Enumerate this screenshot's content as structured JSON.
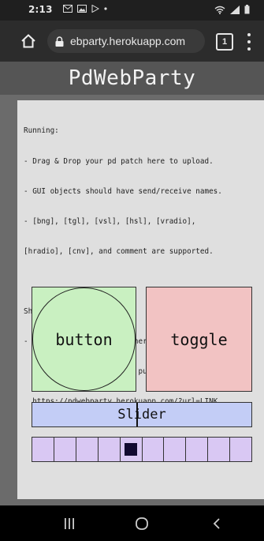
{
  "status_bar": {
    "time": "2:13",
    "left_icons": [
      "gmail-icon",
      "image-icon",
      "play-icon",
      "dot-icon"
    ],
    "right_icons": [
      "wifi-icon",
      "signal-icon",
      "battery-icon"
    ]
  },
  "browser": {
    "url": "ebparty.herokuapp.com",
    "tab_count": "1"
  },
  "page": {
    "title": "PdWebParty",
    "info_lines": [
      "Running:",
      "- Drag & Drop your pd patch here to upload.",
      "- GUI objects should have send/receive names.",
      "- [bng], [tgl], [vsl], [hsl], [vradio],",
      "[hradio], [cnv], and comment are supported.",
      "",
      "Sharing:",
      "- Upload your patch somewhere on the internet",
      "  (e.g. Patchstorage) and put the download LINK",
      "  https://pdwebparty.herokuapp.com/?url=LINK"
    ]
  },
  "gui": {
    "button": {
      "label": "button",
      "color": "#c9f0c1"
    },
    "toggle": {
      "label": "toggle",
      "color": "#f2c3c3"
    },
    "slider": {
      "label": "Slider",
      "color": "#c3cdf6",
      "value_fraction": 0.48
    },
    "radio": {
      "cells": 10,
      "selected_index": 4,
      "color": "#d9c8f3"
    }
  },
  "nav": {
    "items": [
      "recent-apps-icon",
      "home-icon",
      "back-icon"
    ]
  }
}
